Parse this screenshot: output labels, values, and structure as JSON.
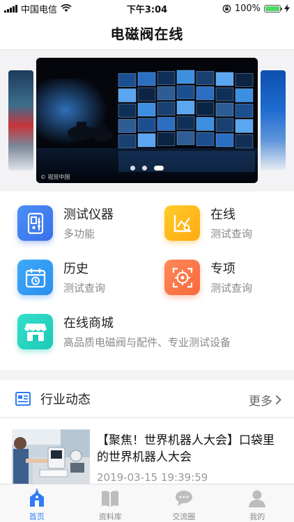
{
  "status_bar": {
    "carrier": "中国电信",
    "time": "下午3:04",
    "battery": "100%",
    "battery_level": 1.0
  },
  "nav": {
    "title": "电磁阀在线"
  },
  "banner": {
    "watermark": "© 视觉中国",
    "slide_count": 3,
    "active_index": 2
  },
  "features": [
    {
      "title": "测试仪器",
      "subtitle": "多功能",
      "icon": "instrument-icon",
      "color_from": "#4a8ff7",
      "color_to": "#3b6fe8"
    },
    {
      "title": "在线",
      "subtitle": "测试查询",
      "icon": "chart-icon",
      "color_from": "#ffcc2a",
      "color_to": "#ffa912"
    },
    {
      "title": "历史",
      "subtitle": "测试查询",
      "icon": "calendar-icon",
      "color_from": "#3fa9f7",
      "color_to": "#2a8ef0"
    },
    {
      "title": "专项",
      "subtitle": "测试查询",
      "icon": "target-icon",
      "color_from": "#ff8a5a",
      "color_to": "#f8683a"
    },
    {
      "title": "在线商城",
      "subtitle": "高品质电磁阀与配件、专业测试设备",
      "icon": "shop-icon",
      "color_from": "#34e0cc",
      "color_to": "#1dc8b4"
    }
  ],
  "news": {
    "section_title": "行业动态",
    "more_label": "更多",
    "items": [
      {
        "headline": "【聚焦！世界机器人大会】口袋里的世界机器人大会",
        "date": "2019-03-15 19:39:59"
      }
    ]
  },
  "tabs": [
    {
      "label": "首页",
      "icon": "home-icon",
      "active": true
    },
    {
      "label": "资料库",
      "icon": "book-icon",
      "active": false
    },
    {
      "label": "交流圈",
      "icon": "chat-icon",
      "active": false
    },
    {
      "label": "我的",
      "icon": "profile-icon",
      "active": false
    }
  ],
  "colors": {
    "accent": "#2f7cf6",
    "inactive": "#bdbdbd"
  }
}
